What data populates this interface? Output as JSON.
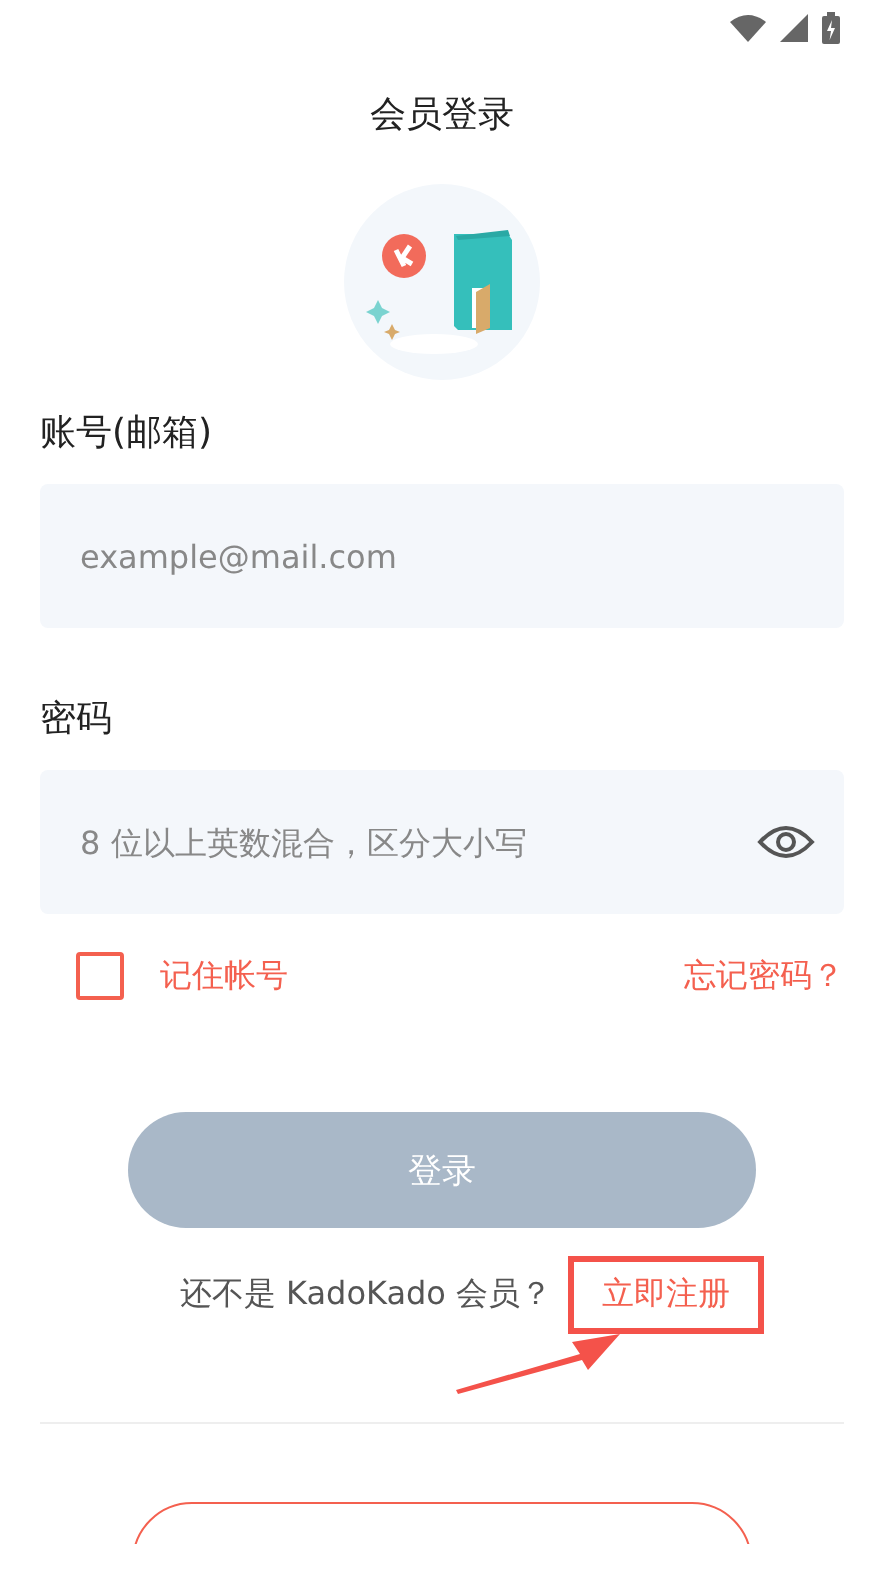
{
  "header": {
    "title": "会员登录"
  },
  "account": {
    "label": "账号(邮箱)",
    "placeholder": "example@mail.com"
  },
  "password": {
    "label": "密码",
    "placeholder": "8 位以上英数混合，区分大小写"
  },
  "remember": {
    "label": "记住帐号",
    "checked": false
  },
  "forgot_link": "忘记密码？",
  "login_button": {
    "label": "登录",
    "disabled": true
  },
  "register": {
    "prompt": "还不是 KadoKado 会员？",
    "link": "立即注册"
  }
}
